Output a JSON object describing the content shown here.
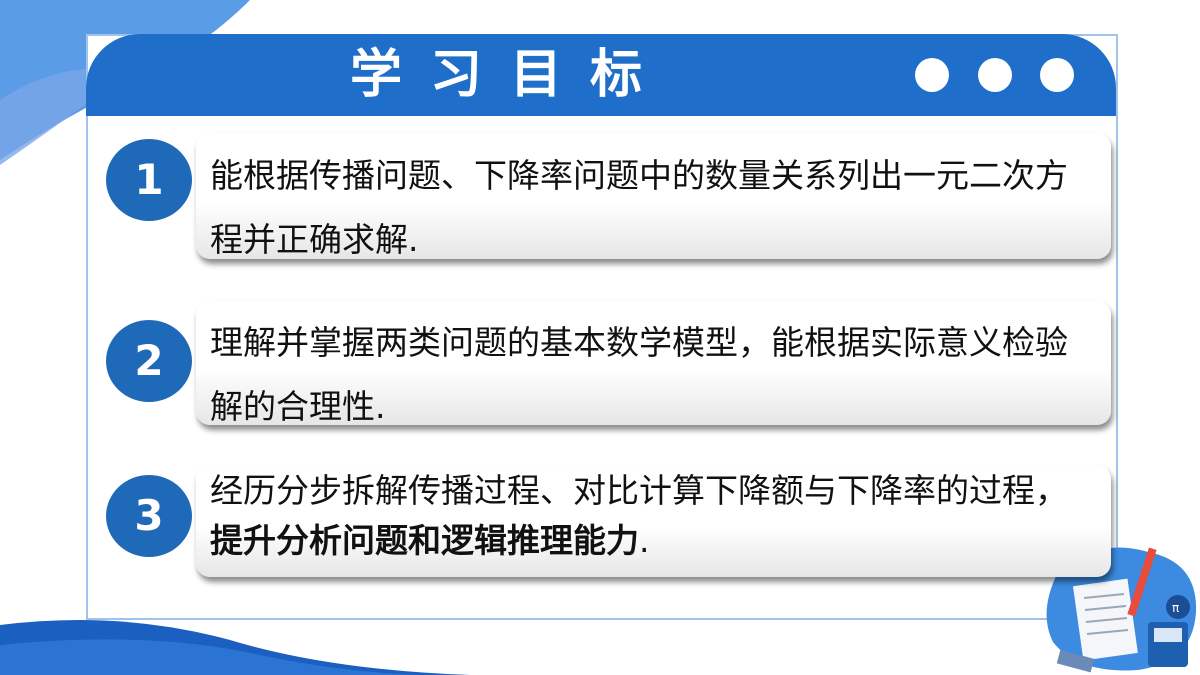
{
  "header": {
    "title": "学习目标"
  },
  "goals": [
    {
      "number": "1",
      "text": "能根据传播问题、下降率问题中的数量关系列出一元二次方程并正确求解."
    },
    {
      "number": "2",
      "text": "理解并掌握两类问题的基本数学模型，能根据实际意义检验解的合理性."
    },
    {
      "number": "3",
      "text": "经历分步拆解传播过程、对比计算下降额与下降率的过程，",
      "bold_text": "提升分析问题和逻辑推理能力",
      "end_text": "."
    }
  ],
  "colors": {
    "accent": "#1f6fca",
    "badge": "#1f6ab8",
    "frame": "#9fc3ea",
    "text": "#111111"
  }
}
